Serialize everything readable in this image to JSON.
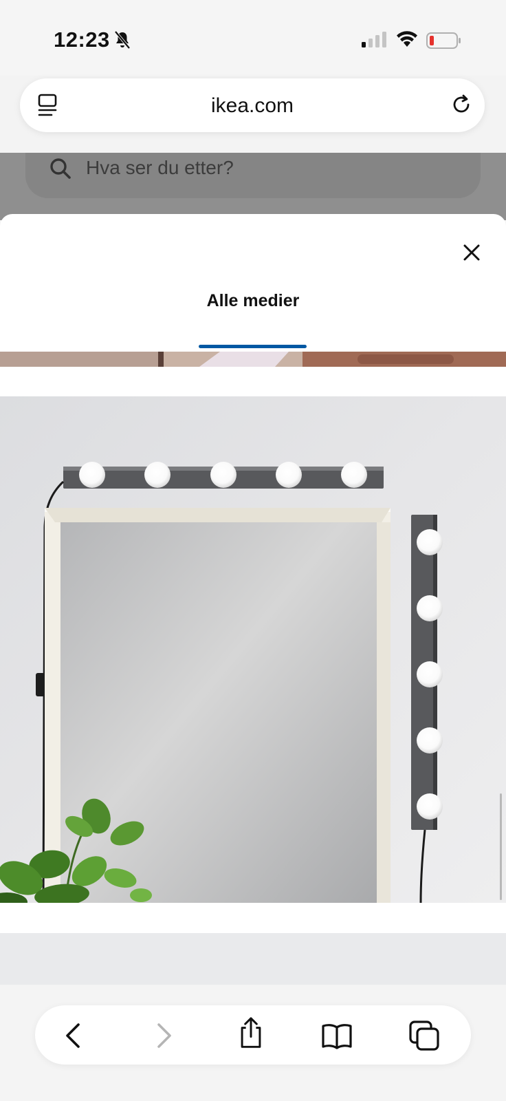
{
  "status_bar": {
    "time": "12:23",
    "battery_color": "#e5322d"
  },
  "browser": {
    "url": "ikea.com"
  },
  "page": {
    "search_placeholder": "Hva ser du etter?"
  },
  "media_sheet": {
    "tabs": [
      {
        "label": "Alle medier",
        "active": true
      }
    ],
    "accent_color": "#0058a3"
  },
  "toolbar": {
    "icons": [
      "back-icon",
      "forward-icon",
      "share-icon",
      "bookmarks-icon",
      "tabs-icon"
    ]
  }
}
